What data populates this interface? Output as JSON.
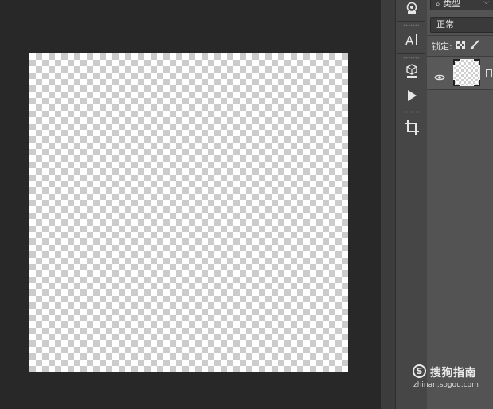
{
  "layers_panel": {
    "filter_label": "类型",
    "filter_chevron": "⌵",
    "blend_mode": "正常",
    "lock_label": "锁定:",
    "layer_name_fragment": ""
  },
  "watermark": {
    "mark": "S",
    "name": "搜狗指南",
    "url": "zhinan.sogou.com"
  },
  "tools": [
    "info-icon",
    "character-icon",
    "3d-icon",
    "play-icon",
    "crop-icon"
  ],
  "colors": {
    "workspace": "#282828",
    "panel": "#535353",
    "toolbar": "#464646"
  }
}
